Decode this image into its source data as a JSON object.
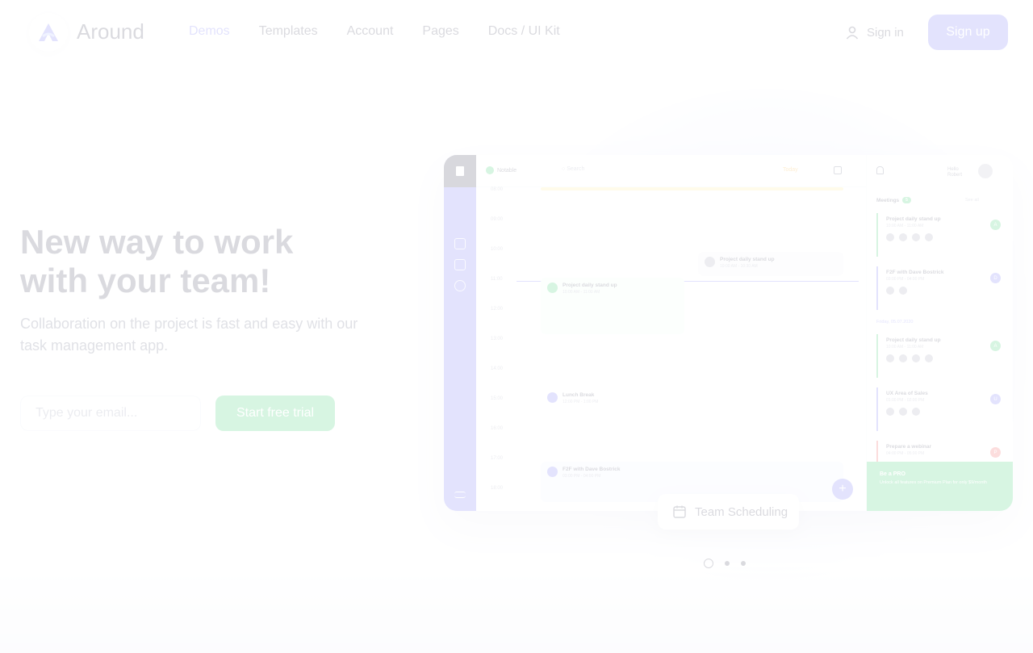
{
  "header": {
    "brand": "Around",
    "nav": [
      "Demos",
      "Templates",
      "Account",
      "Pages",
      "Docs / UI Kit"
    ],
    "signin_label": "Sign in",
    "signup_label": "Sign up"
  },
  "hero": {
    "title_line1": "New way to work",
    "title_line2": "with your team!",
    "subtitle": "Collaboration on the project is fast and easy with our task management app.",
    "email_placeholder": "Type your email...",
    "cta_label": "Start free trial"
  },
  "mockup": {
    "team_label": "Notable",
    "search_placeholder": "Search",
    "today_label": "Today",
    "hello": "Hello",
    "user_name": "Robert",
    "times": [
      "08:00",
      "09:00",
      "10:00",
      "11:00",
      "12:00",
      "13:00",
      "14:00",
      "15:00",
      "16:00",
      "17:00",
      "18:00"
    ],
    "events": [
      {
        "title": "Project daily stand up",
        "time": "10:00 AM - 10:30 AM"
      },
      {
        "title": "Project daily stand up",
        "time": "10:00 AM - 11:00 AM"
      },
      {
        "title": "Lunch Break",
        "time": "12:00 PM - 1:00 PM"
      },
      {
        "title": "F2F with Dave Bostrick",
        "time": "03:00 PM - 04:00 PM"
      }
    ],
    "meetings_title": "Meetings",
    "meetings_count": "5",
    "see_all": "See all",
    "meetings": [
      {
        "title": "Project daily stand up",
        "time": "10:00 AM - 11:00 AM",
        "mark": "A"
      },
      {
        "title": "F2F with Dave Bostrick",
        "time": "03:00 PM - 04:00 PM",
        "mark": "D"
      },
      {
        "title": "Project daily stand up",
        "time": "10:00 AM - 11:00 AM",
        "mark": "A"
      },
      {
        "title": "UX Area of Sales",
        "time": "01:00 PM - 02:00 PM",
        "mark": "U"
      },
      {
        "title": "Prepare a webinar",
        "time": "04:00 PM - 05:00 PM",
        "mark": "P"
      }
    ],
    "day_label": "Friday, 05.07.2020",
    "pro_title": "Be a PRO",
    "pro_text": "Unlock all features on Premium Plan for only $9/month",
    "colors": {
      "accent": "#6366f1",
      "success": "#22c55e",
      "danger": "#ef4444",
      "warning": "#f59e0b"
    }
  },
  "schedule_chip": "Team Scheduling",
  "carousel": {
    "slides": 3,
    "active": 1
  }
}
